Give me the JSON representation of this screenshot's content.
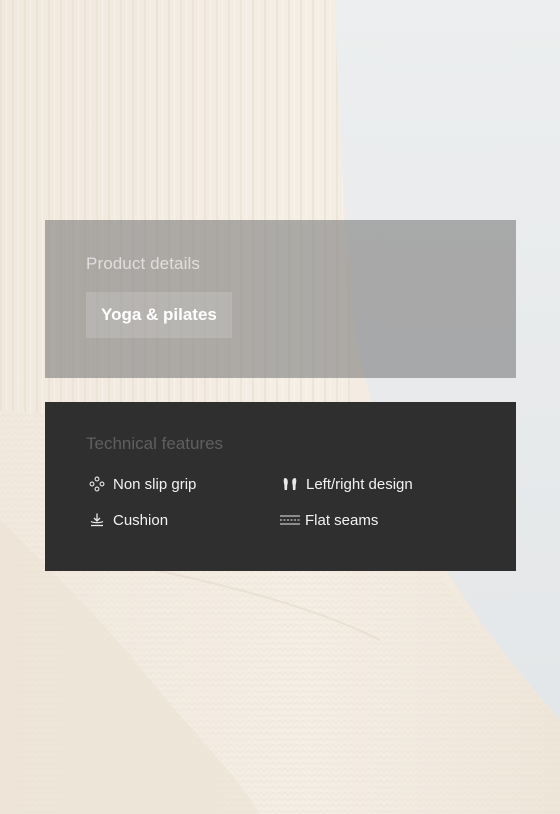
{
  "product_details": {
    "title": "Product details",
    "tag_label": "Yoga & pilates"
  },
  "technical_features": {
    "title": "Technical features",
    "items": [
      {
        "label": "Non slip grip",
        "icon": "grip-dots-icon"
      },
      {
        "label": "Left/right design",
        "icon": "feet-icon"
      },
      {
        "label": "Cushion",
        "icon": "cushion-icon"
      },
      {
        "label": "Flat seams",
        "icon": "flat-seams-icon"
      }
    ]
  },
  "colors": {
    "details_panel": "#808080",
    "features_panel": "#2f2f2f",
    "sock": "#f3ece2",
    "backdrop": "#e6e9eb"
  }
}
